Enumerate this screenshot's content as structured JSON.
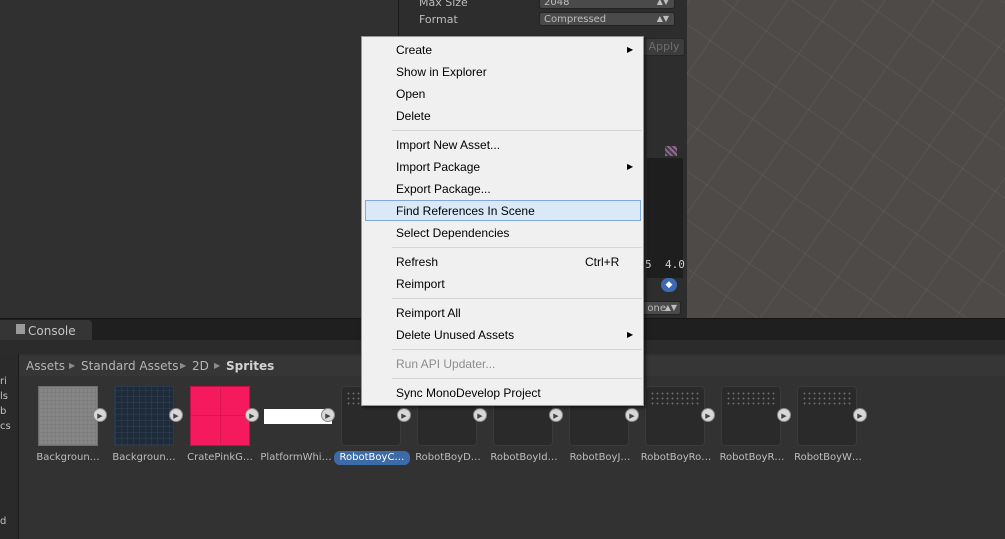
{
  "inspector": {
    "max_size_label": "Max Size",
    "max_size_value": "2048",
    "format_label": "Format",
    "format_value": "Compressed",
    "apply_label": "Apply",
    "preview_num1": "5",
    "preview_num2": "4.0",
    "none_dropdown": "one"
  },
  "console_tab": {
    "label": "Console"
  },
  "breadcrumb": [
    "Assets",
    "Standard Assets",
    "2D",
    "Sprites"
  ],
  "assets": [
    {
      "label": "Backgroun…"
    },
    {
      "label": "Backgroun…"
    },
    {
      "label": "CratePinkG…"
    },
    {
      "label": "PlatformWhi…"
    },
    {
      "label": "RobotBoyC…",
      "selected": true
    },
    {
      "label": "RobotBoyD…"
    },
    {
      "label": "RobotBoyId…"
    },
    {
      "label": "RobotBoyJ…"
    },
    {
      "label": "RobotBoyRo…"
    },
    {
      "label": "RobotBoyR…"
    },
    {
      "label": "RobotBoyW…"
    }
  ],
  "context_menu": {
    "items": [
      {
        "label": "Create",
        "submenu": true
      },
      {
        "label": "Show in Explorer"
      },
      {
        "label": "Open"
      },
      {
        "label": "Delete"
      },
      {
        "label": "Import New Asset..."
      },
      {
        "label": "Import Package",
        "submenu": true
      },
      {
        "label": "Export Package..."
      },
      {
        "label": "Find References In Scene",
        "highlighted": true
      },
      {
        "label": "Select Dependencies"
      },
      {
        "label": "Refresh",
        "shortcut": "Ctrl+R"
      },
      {
        "label": "Reimport"
      },
      {
        "label": "Reimport All"
      },
      {
        "label": "Delete Unused Assets",
        "submenu": true
      },
      {
        "label": "Run API Updater...",
        "disabled": true
      },
      {
        "label": "Sync MonoDevelop Project"
      }
    ]
  },
  "tree_fragments": [
    "ri",
    "ls",
    "b",
    "cs",
    "d"
  ],
  "colors": {
    "menu_bg": "#f0f0f0",
    "menu_highlight": "#d9e9f8",
    "selection_blue": "#3d6ba7",
    "panel_dark": "#323232"
  }
}
